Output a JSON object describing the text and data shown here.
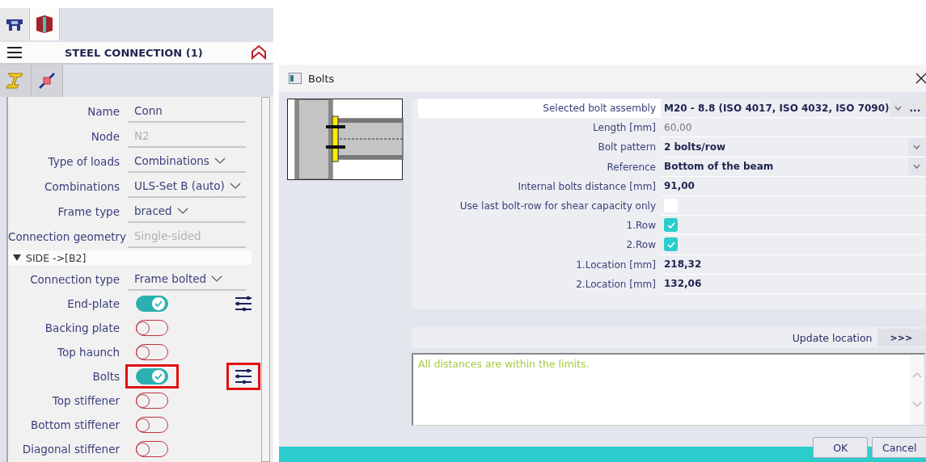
{
  "panel": {
    "tabs": [
      {
        "selected": false
      },
      {
        "selected": true
      }
    ],
    "title": "STEEL CONNECTION (1)",
    "properties": [
      {
        "label": "Name",
        "value": "Conn",
        "kind": "text"
      },
      {
        "label": "Node",
        "value": "N2",
        "kind": "disabled"
      },
      {
        "label": "Type of loads",
        "value": "Combinations",
        "kind": "dropdown"
      },
      {
        "label": "Combinations",
        "value": "ULS-Set B (auto)",
        "kind": "dropdown"
      },
      {
        "label": "Frame type",
        "value": "braced",
        "kind": "dropdown"
      },
      {
        "label": "Connection geometry",
        "value": "Single-sided",
        "kind": "disabled"
      }
    ],
    "section": {
      "title": "SIDE ->[B2]",
      "expanded": true,
      "type": {
        "label": "Connection type",
        "value": "Frame bolted",
        "kind": "dropdown"
      },
      "components": [
        {
          "label": "End-plate",
          "on": true,
          "settings": true,
          "highlighted": false
        },
        {
          "label": "Backing plate",
          "on": false,
          "settings": false,
          "highlighted": false
        },
        {
          "label": "Top haunch",
          "on": false,
          "settings": false,
          "highlighted": false
        },
        {
          "label": "Bolts",
          "on": true,
          "settings": true,
          "highlighted": true
        },
        {
          "label": "Top stiffener",
          "on": false,
          "settings": false,
          "highlighted": false
        },
        {
          "label": "Bottom stiffener",
          "on": false,
          "settings": false,
          "highlighted": false
        },
        {
          "label": "Diagonal stiffener",
          "on": false,
          "settings": false,
          "highlighted": false
        }
      ]
    }
  },
  "dialog": {
    "title": "Bolts",
    "fields": [
      {
        "label": "Selected bolt assembly",
        "value": "M20 - 8.8 (ISO 4017, ISO 4032, ISO 7090)",
        "kind": "dropdown",
        "more": "...",
        "focused": true
      },
      {
        "label": "Length [mm]",
        "value": "60,00",
        "kind": "readonly",
        "focused": false
      },
      {
        "label": "Bolt pattern",
        "value": "2 bolts/row",
        "kind": "dropdown",
        "focused": false
      },
      {
        "label": "Reference",
        "value": "Bottom of the beam",
        "kind": "dropdown",
        "focused": false
      },
      {
        "label": "Internal bolts distance [mm]",
        "value": "91,00",
        "kind": "value",
        "focused": false
      },
      {
        "label": "Use last bolt-row for shear capacity only",
        "checked": false,
        "kind": "checkbox",
        "focused": false
      },
      {
        "label": "1.Row",
        "checked": true,
        "kind": "checkbox",
        "focused": false
      },
      {
        "label": "2.Row",
        "checked": true,
        "kind": "checkbox",
        "focused": false
      },
      {
        "label": "1.Location [mm]",
        "value": "218,32",
        "kind": "value",
        "focused": false
      },
      {
        "label": "2.Location [mm]",
        "value": "132,06",
        "kind": "value",
        "focused": false
      }
    ],
    "update_label": "Update location",
    "update_button": ">>>",
    "message": "All distances are within the limits.",
    "buttons": [
      "OK",
      "Cancel"
    ]
  }
}
